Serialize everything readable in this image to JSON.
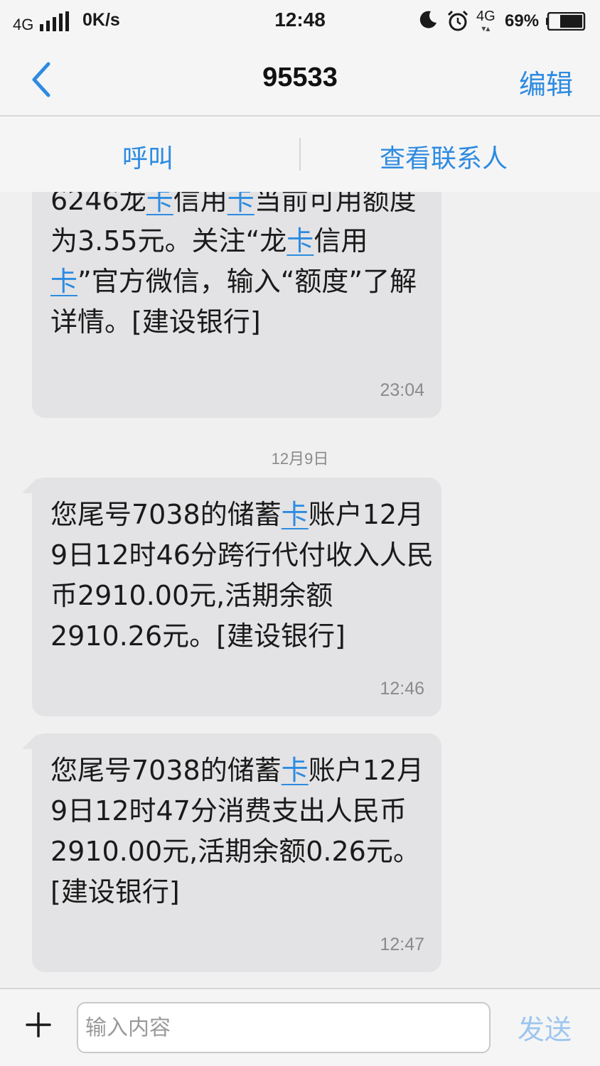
{
  "status_bar": {
    "network": "4G",
    "speed": "0K/s",
    "time": "12:48",
    "network_secondary": "4G",
    "battery_percent": "69%",
    "battery_level": 0.69
  },
  "header": {
    "title": "95533",
    "edit_label": "编辑"
  },
  "actions": {
    "call_label": "呼叫",
    "view_contact_label": "查看联系人"
  },
  "messages": [
    {
      "parts": [
        "6246龙",
        "卡",
        "信用",
        "卡",
        "当前可用额度为3.55元。关注“龙",
        "卡",
        "信用",
        "卡",
        "”官方微信，输入“额度”了解详情。[建设银行]"
      ],
      "time": "23:04"
    },
    {
      "date_separator": "12月9日"
    },
    {
      "parts": [
        "您尾号7038的储蓄",
        "卡",
        "账户12月9日12时46分跨行代付收入人民币2910.00元,活期余额2910.26元。[建设银行]"
      ],
      "time": "12:46"
    },
    {
      "parts": [
        "您尾号7038的储蓄",
        "卡",
        "账户12月9日12时47分消费支出人民币2910.00元,活期余额0.26元。[建设银行]"
      ],
      "time": "12:47"
    }
  ],
  "composer": {
    "placeholder": "输入内容",
    "send_label": "发送"
  },
  "colors": {
    "accent": "#2d8be0",
    "send_disabled": "#9dc6ee",
    "bubble": "#e3e3e5",
    "background": "#f0f0f1"
  }
}
